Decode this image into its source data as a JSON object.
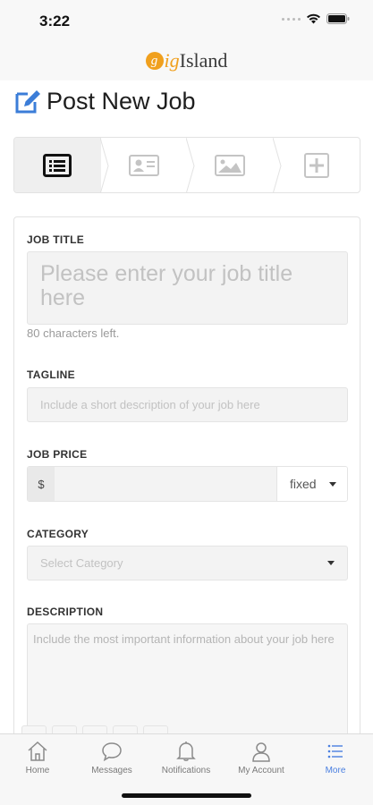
{
  "status_bar": {
    "time": "3:22"
  },
  "header": {
    "logo_g": "g",
    "logo_ig": "ig",
    "logo_island": "Island"
  },
  "page": {
    "title": "Post New Job"
  },
  "stepper": {
    "steps": [
      {
        "icon": "list-icon",
        "active": true
      },
      {
        "icon": "id-card-icon",
        "active": false
      },
      {
        "icon": "image-icon",
        "active": false
      },
      {
        "icon": "plus-square-icon",
        "active": false
      }
    ]
  },
  "form": {
    "job_title": {
      "label": "JOB TITLE",
      "placeholder": "Please enter your job title here",
      "value": "",
      "helper": "80 characters left."
    },
    "tagline": {
      "label": "TAGLINE",
      "placeholder": "Include a short description of your job here",
      "value": ""
    },
    "job_price": {
      "label": "JOB PRICE",
      "currency": "$",
      "value": "",
      "type_selected": "fixed"
    },
    "category": {
      "label": "CATEGORY",
      "placeholder": "Select Category"
    },
    "description": {
      "label": "DESCRIPTION",
      "placeholder": "Include the most important information about your job here"
    }
  },
  "tabbar": {
    "items": [
      {
        "label": "Home",
        "icon": "home-icon",
        "active": false
      },
      {
        "label": "Messages",
        "icon": "chat-icon",
        "active": false
      },
      {
        "label": "Notifications",
        "icon": "bell-icon",
        "active": false
      },
      {
        "label": "My Account",
        "icon": "user-icon",
        "active": false
      },
      {
        "label": "More",
        "icon": "menu-list-icon",
        "active": true
      }
    ]
  },
  "colors": {
    "accent": "#4a7fe0",
    "brand": "#f0a01e",
    "title_icon": "#3b7dd8"
  }
}
